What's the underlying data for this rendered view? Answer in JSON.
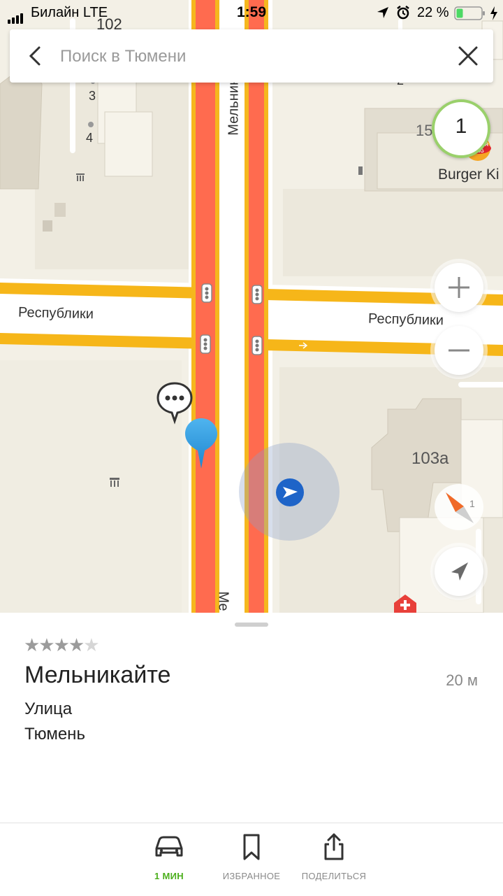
{
  "status_bar": {
    "carrier": "Билайн  LTE",
    "time": "1:59",
    "battery": "22 %"
  },
  "search": {
    "placeholder": "Поиск в Тюмени",
    "value": ""
  },
  "map": {
    "labels": {
      "house_102": "102",
      "house_3": "3",
      "house_4": "4",
      "house_2": "2",
      "house_15": "15",
      "house_103a": "103а",
      "street_respubliki_left": "Республики",
      "street_respubliki_right": "Республики",
      "street_melnikaite_top": "Мельник",
      "street_melnikaite_bottom": "Ме",
      "poi_burger_king": "Burger Ki",
      "burger_king_logo": "BURGER KING"
    },
    "traffic_level": "1",
    "compass_badge": "1",
    "controls": {
      "zoom_in": "+",
      "zoom_out": "−"
    },
    "colors": {
      "road_major": "#f5b71e",
      "traffic_jam": "#ff6b4f",
      "traffic_ring": "#8bc34a",
      "user_location": "#1e64c8",
      "selected_pin": "#2e9be0"
    }
  },
  "place_card": {
    "rating_stars_filled": 4,
    "rating_stars_total": 5,
    "name": "Мельникайте",
    "distance": "20 м",
    "type": "Улица",
    "city": "Тюмень"
  },
  "tabbar": {
    "route_label": "1 МИН",
    "favorites_label": "ИЗБРАННОЕ",
    "share_label": "ПОДЕЛИТЬСЯ"
  }
}
